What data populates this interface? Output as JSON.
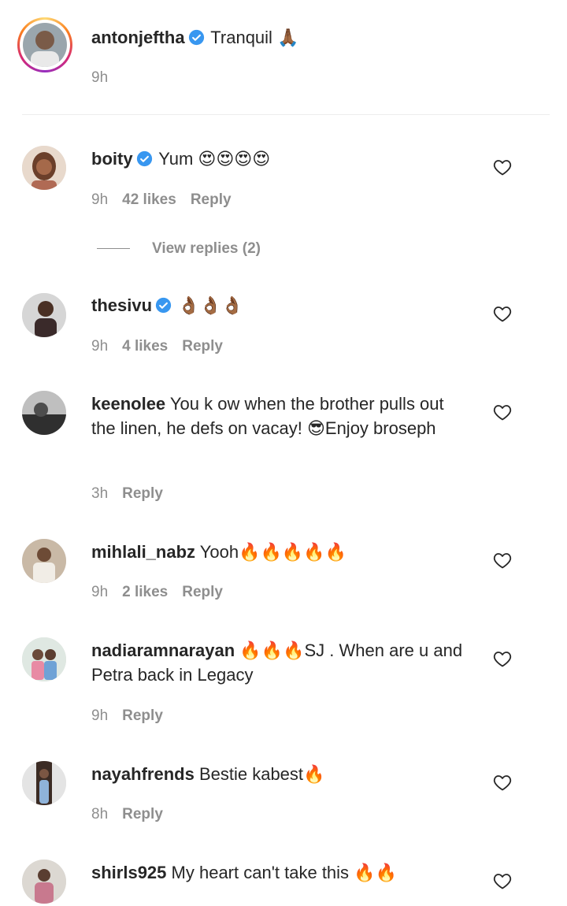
{
  "caption": {
    "username": "antonjeftha",
    "text": "Tranquil 🙏🏾",
    "time": "9h"
  },
  "comments": [
    {
      "username": "boity",
      "verified": true,
      "text": "Yum 😍😍😍😍",
      "time": "9h",
      "likes": "42 likes",
      "reply": "Reply"
    },
    {
      "username": "thesivu",
      "verified": true,
      "text": "👌🏾👌🏾👌🏾",
      "time": "9h",
      "likes": "4 likes",
      "reply": "Reply"
    },
    {
      "username": "keenolee",
      "verified": false,
      "text": "You k ow when the brother pulls out the linen, he defs on vacay! 😎Enjoy broseph",
      "time": "3h",
      "likes": "",
      "reply": "Reply"
    },
    {
      "username": "mihlali_nabz",
      "verified": false,
      "text": "Yooh🔥🔥🔥🔥🔥",
      "time": "9h",
      "likes": "2 likes",
      "reply": "Reply"
    },
    {
      "username": "nadiaramnarayan",
      "verified": false,
      "text": "🔥🔥🔥SJ . When are u and Petra back in Legacy",
      "time": "9h",
      "likes": "",
      "reply": "Reply"
    },
    {
      "username": "nayahfrends",
      "verified": false,
      "text": "Bestie kabest🔥",
      "time": "8h",
      "likes": "",
      "reply": "Reply"
    },
    {
      "username": "shirls925",
      "verified": false,
      "text": "My heart can't take this 🔥🔥",
      "time": "",
      "likes": "",
      "reply": ""
    }
  ],
  "view_replies": "View replies (2)",
  "colors": {
    "verified": "#3897f0",
    "meta": "#8e8e8e",
    "text": "#262626"
  },
  "icons": {
    "heart": "heart-outline-icon",
    "verified": "verified-badge-icon"
  }
}
